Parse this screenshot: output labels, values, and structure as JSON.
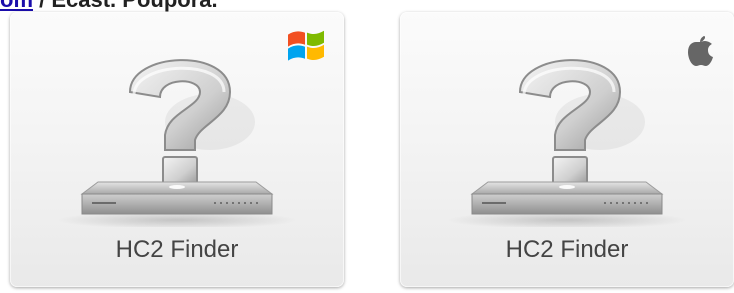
{
  "header": {
    "link_text": "om",
    "text": " / Ecast. Poupora."
  },
  "cards": [
    {
      "label": "HC2 Finder",
      "os_icon": "windows-logo-icon",
      "os_colors": [
        "#f25022",
        "#7fba00",
        "#00a4ef",
        "#ffb900"
      ]
    },
    {
      "label": "HC2 Finder",
      "os_icon": "apple-logo-icon",
      "os_colors": [
        "#666666"
      ]
    }
  ]
}
